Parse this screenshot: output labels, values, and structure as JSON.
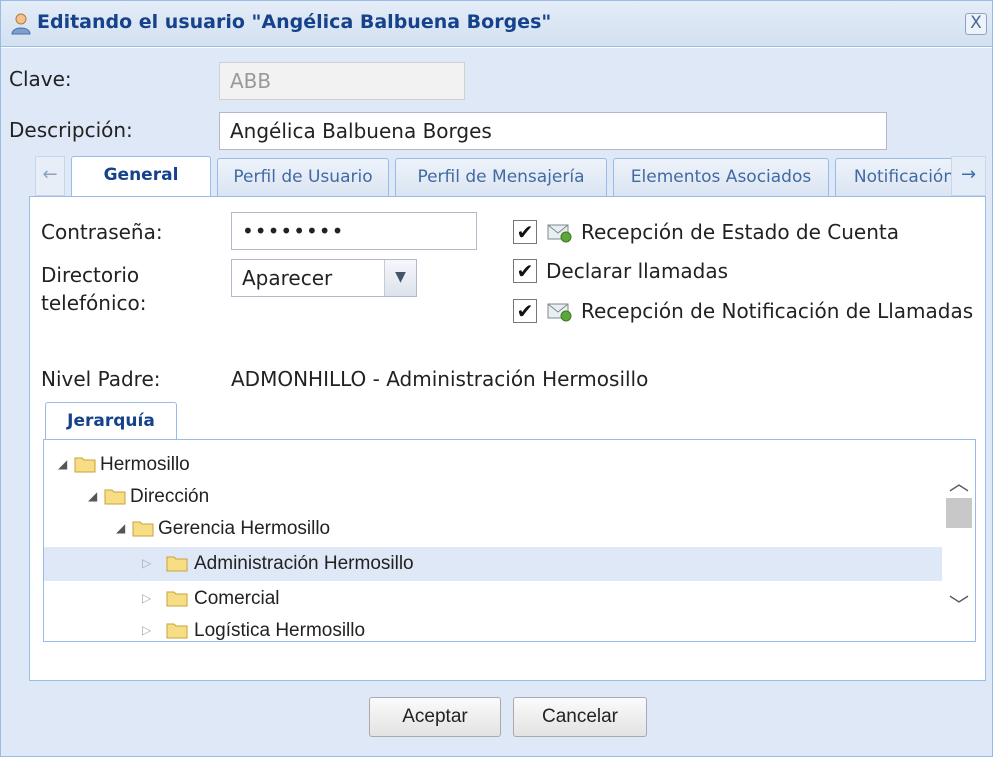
{
  "window": {
    "title": "Editando el usuario \"Angélica Balbuena Borges\"",
    "close_label": "X"
  },
  "form": {
    "clave_label": "Clave:",
    "clave_value": "ABB",
    "descripcion_label": "Descripción:",
    "descripcion_value": "Angélica Balbuena Borges"
  },
  "tabs": [
    {
      "label": "General",
      "active": true
    },
    {
      "label": "Perfil de Usuario",
      "active": false
    },
    {
      "label": "Perfil de Mensajería",
      "active": false
    },
    {
      "label": "Elementos Asociados",
      "active": false
    },
    {
      "label": "Notificación",
      "active": false
    }
  ],
  "tab_scroll": {
    "left_icon": "←",
    "right_icon": "→"
  },
  "general": {
    "password_label": "Contraseña:",
    "password_value": "••••••••",
    "directorio_label_line1": "Directorio",
    "directorio_label_line2": "telefónico:",
    "directorio_value": "Aparecer",
    "checkboxes": [
      {
        "label": "Recepción de Estado de Cuenta",
        "checked": true,
        "icon": "envelope-icon"
      },
      {
        "label": "Declarar llamadas",
        "checked": true,
        "icon": ""
      },
      {
        "label": "Recepción de Notificación de Llamadas",
        "checked": true,
        "icon": "envelope-icon"
      }
    ],
    "nivel_padre_label": "Nivel Padre:",
    "nivel_padre_value": "ADMONHILLO - Administración Hermosillo"
  },
  "hierarchy": {
    "tab_label": "Jerarquía",
    "nodes": [
      {
        "label": "Hermosillo",
        "level": 0,
        "expanded": true,
        "selected": false
      },
      {
        "label": "Dirección",
        "level": 1,
        "expanded": true,
        "selected": false
      },
      {
        "label": "Gerencia Hermosillo",
        "level": 2,
        "expanded": true,
        "selected": false
      },
      {
        "label": "Administración Hermosillo",
        "level": 3,
        "expanded": false,
        "selected": true
      },
      {
        "label": "Comercial",
        "level": 3,
        "expanded": false,
        "selected": false
      },
      {
        "label": "Logística Hermosillo",
        "level": 3,
        "expanded": false,
        "selected": false
      }
    ]
  },
  "buttons": {
    "accept": "Aceptar",
    "cancel": "Cancelar"
  },
  "colors": {
    "title_text": "#15428b",
    "panel_bg": "#dfe8f6",
    "border": "#99bbe8",
    "selected_row": "#dfe8f6"
  }
}
